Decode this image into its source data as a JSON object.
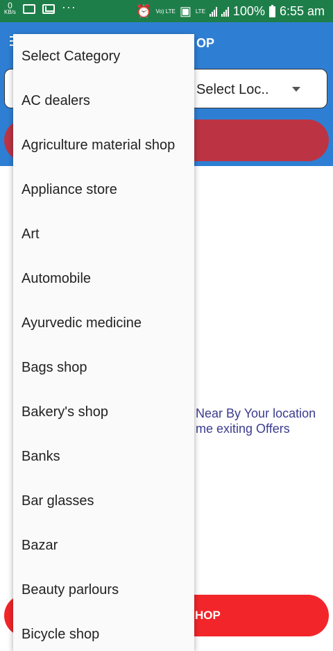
{
  "status_bar": {
    "speed_value": "0",
    "speed_unit": "KB/s",
    "dots": "···",
    "volte_label": "Vo) LTE",
    "lte_label": "LTE",
    "battery": "100%",
    "time": "6:55 am"
  },
  "header": {
    "title": "OP",
    "location_placeholder": "Select Loc.."
  },
  "main": {
    "promo_line1": "Near By Your location",
    "promo_line2": "me exiting Offers",
    "bottom_button_label": "HOP"
  },
  "category_popup": {
    "items": [
      "Select Category",
      "AC dealers",
      "Agriculture material shop",
      "Appliance store",
      "Art",
      "Automobile",
      "Ayurvedic medicine",
      "Bags shop",
      "Bakery's shop",
      "Banks",
      "Bar glasses",
      "Bazar",
      "Beauty parlours",
      "Bicycle shop"
    ]
  }
}
